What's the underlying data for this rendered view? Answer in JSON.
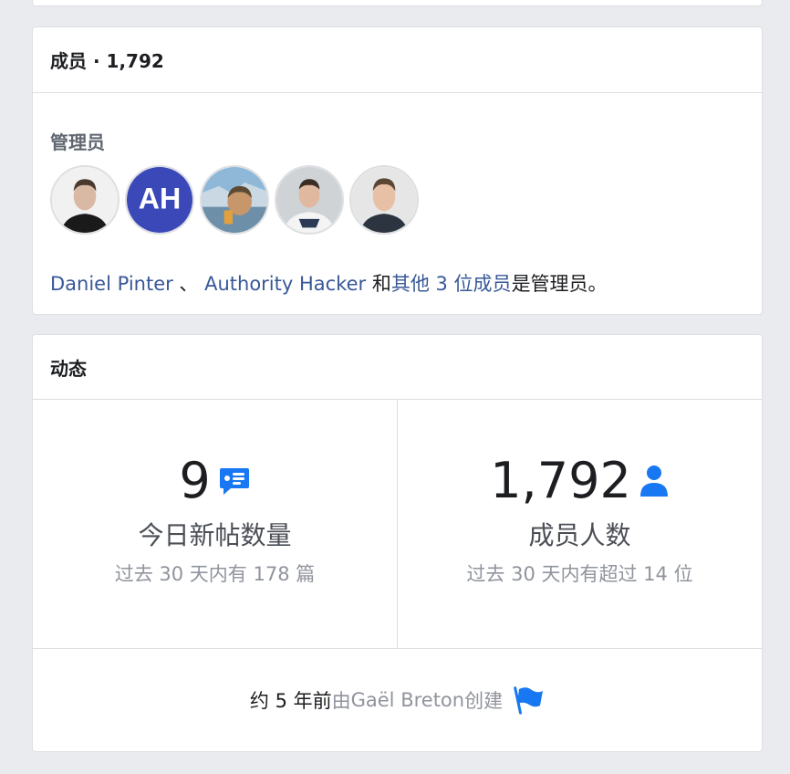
{
  "members_card": {
    "title": "成员 · 1,792",
    "admins_label": "管理员",
    "avatars": [
      "avatar-daniel-pinter",
      "avatar-authority-hacker",
      "avatar-admin-3",
      "avatar-admin-4",
      "avatar-admin-5"
    ],
    "ah_initials": "AH",
    "admins_text": {
      "name1": "Daniel Pinter",
      "sep": " 、 ",
      "name2": "Authority Hacker",
      "and": " 和",
      "others": "其他 3 位成员",
      "suffix": "是管理员。"
    }
  },
  "activity_card": {
    "title": "动态",
    "posts": {
      "value": "9",
      "title": "今日新帖数量",
      "sub": "过去 30 天内有 178 篇",
      "icon": "chat-bubble-icon"
    },
    "members": {
      "value": "1,792",
      "title": "成员人数",
      "sub": "过去 30 天内有超过 14 位",
      "icon": "person-icon"
    },
    "footer": {
      "ago": "约 5 年前",
      "by": " 由 ",
      "creator": "Gaël Breton",
      "created": " 创建",
      "icon": "flag-icon"
    }
  },
  "colors": {
    "link": "#385898",
    "accent": "#1877f2",
    "muted": "#90949c",
    "ah_bg": "#3b48b8"
  }
}
